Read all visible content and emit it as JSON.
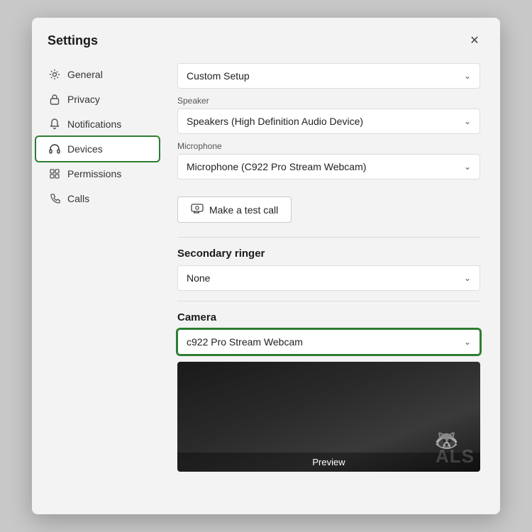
{
  "dialog": {
    "title": "Settings",
    "close_label": "✕"
  },
  "sidebar": {
    "items": [
      {
        "id": "general",
        "label": "General",
        "icon": "gear"
      },
      {
        "id": "privacy",
        "label": "Privacy",
        "icon": "lock"
      },
      {
        "id": "notifications",
        "label": "Notifications",
        "icon": "bell"
      },
      {
        "id": "devices",
        "label": "Devices",
        "icon": "headset",
        "active": true
      },
      {
        "id": "permissions",
        "label": "Permissions",
        "icon": "grid"
      },
      {
        "id": "calls",
        "label": "Calls",
        "icon": "phone"
      }
    ]
  },
  "main": {
    "setup_dropdown": {
      "value": "Custom Setup"
    },
    "speaker_label": "Speaker",
    "speaker_dropdown": {
      "value": "Speakers (High Definition Audio Device)"
    },
    "microphone_label": "Microphone",
    "microphone_dropdown": {
      "value": "Microphone (C922 Pro Stream Webcam)"
    },
    "test_call_button": "Make a test call",
    "secondary_ringer_title": "Secondary ringer",
    "secondary_ringer_dropdown": {
      "value": "None"
    },
    "camera_title": "Camera",
    "camera_dropdown": {
      "value": "c922 Pro Stream Webcam"
    },
    "preview_label": "Preview"
  }
}
